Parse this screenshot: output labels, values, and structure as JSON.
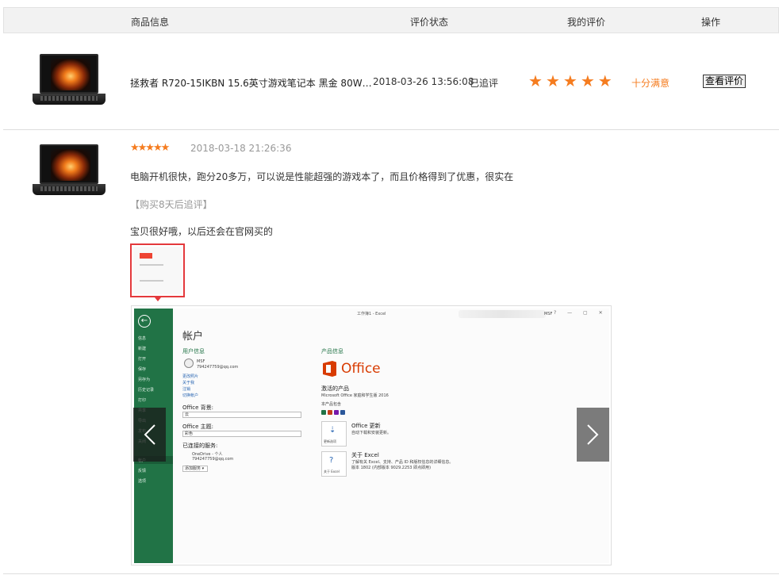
{
  "header": {
    "col_product": "商品信息",
    "col_status": "评价状态",
    "col_my_review": "我的评价",
    "col_action": "操作"
  },
  "order": {
    "product_name": "拯救者 R720-15IKBN 15.6英寸游戏笔记本 黑金 80W…",
    "date": "2018-03-26 13:56:08",
    "status": "已追评",
    "rating": 5,
    "rating_text": "十分满意",
    "view_button": "查看评价"
  },
  "review": {
    "stars": "★★★★★",
    "date": "2018-03-18 21:26:36",
    "text": "电脑开机很快，跑分20多万，可以说是性能超强的游戏本了，而且价格得到了优惠，很实在",
    "follow_tag": "【购买8天后追评】",
    "follow_text": "宝贝很好哦，以后还会在官网买的"
  },
  "screenshot": {
    "title": "工作簿1 - Excel",
    "user_short": "MSF",
    "window_controls": "? — ▢ ✕",
    "nav": [
      "信息",
      "新建",
      "打开",
      "保存",
      "另存为",
      "历史记录",
      "打印",
      "共享",
      "导出",
      "发布",
      "关闭",
      "帐户",
      "反馈",
      "选项"
    ],
    "heading": "帐户",
    "user_info": "用户信息",
    "user_name": "MSF",
    "user_email": "794247759@qq.com",
    "links": [
      "更改照片",
      "关于我",
      "注销",
      "切换帐户"
    ],
    "office_background_label": "Office 背景:",
    "office_background_value": "云",
    "office_theme_label": "Office 主题:",
    "office_theme_value": "彩色",
    "connected_services": "已连接的服务:",
    "onedrive": "OneDrive - 个人",
    "onedrive_email": "794247759@qq.com",
    "add_service": "添加服务 ▾",
    "product_info": "产品信息",
    "office_logo": "Office",
    "activated": "激活的产品",
    "product_line": "Microsoft Office 家庭和学生版 2016",
    "includes": "本产品包含",
    "update_title": "Office 更新",
    "update_desc": "自动下载和安装更新。",
    "update_btn": "更新选项",
    "about_title": "关于 Excel",
    "about_desc1": "了解有关 Excel、支持、产品 ID 和版权信息的详细信息。",
    "about_desc2": "版本 1802 (内部版本 9029.2253 即点即用)",
    "about_btn": "关于 Excel"
  },
  "colors": {
    "accent_orange": "#f57c1f",
    "thumb_border": "#e4393c",
    "excel_green": "#217346"
  }
}
